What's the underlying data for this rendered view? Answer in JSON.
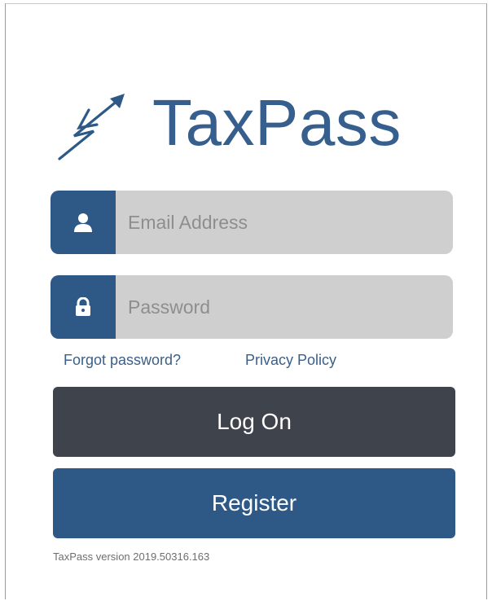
{
  "app": {
    "name": "TaxPass",
    "brand_color": "#2e5987",
    "text_brand_color": "#365f8d"
  },
  "form": {
    "email": {
      "placeholder": "Email Address",
      "value": "",
      "icon": "user-icon"
    },
    "password": {
      "placeholder": "Password",
      "value": "",
      "icon": "lock-icon"
    }
  },
  "links": {
    "forgot": "Forgot password?",
    "privacy": "Privacy Policy"
  },
  "buttons": {
    "logon": "Log On",
    "logon_color": "#3f434c",
    "register": "Register",
    "register_color": "#2e5987"
  },
  "footer": {
    "version": "TaxPass version 2019.50316.163"
  }
}
